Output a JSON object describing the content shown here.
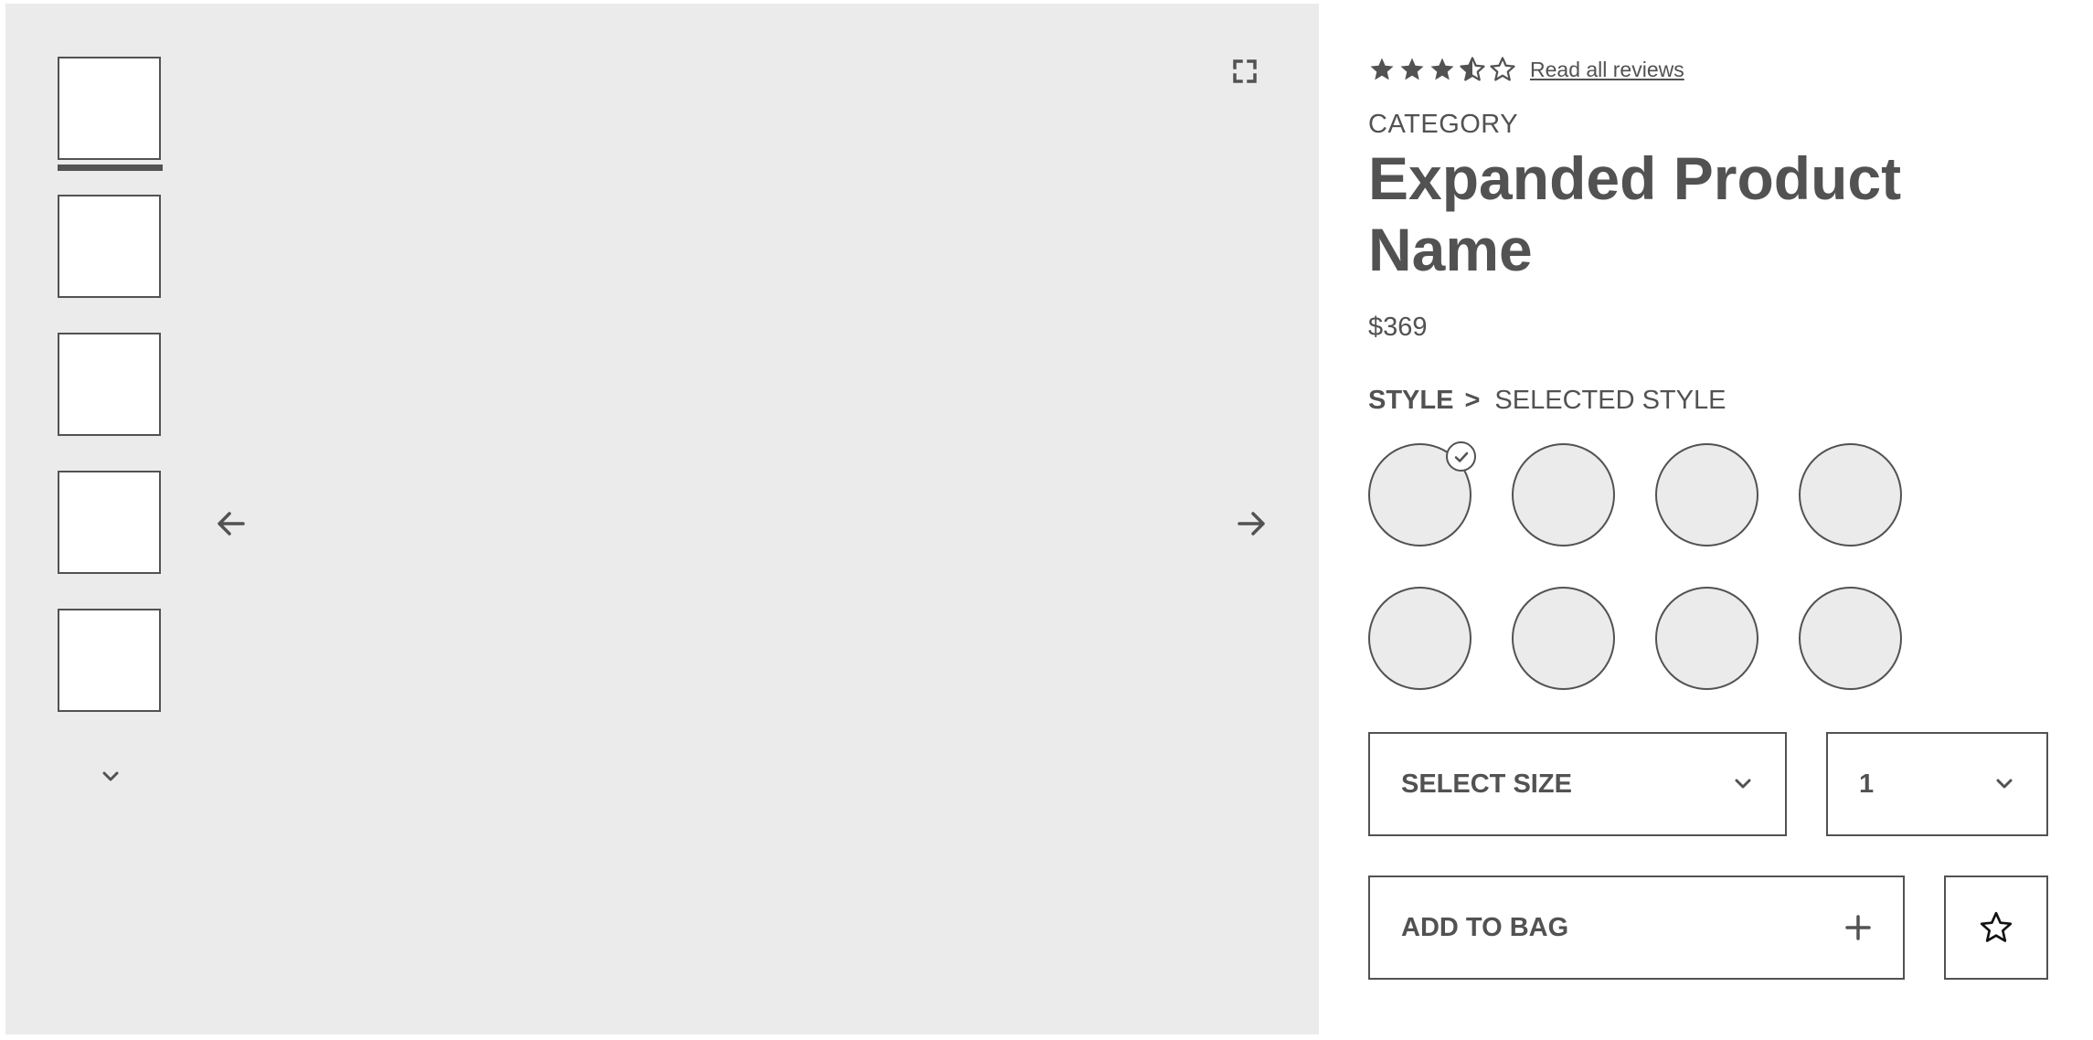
{
  "gallery": {
    "thumbnail_count": 5,
    "selected_thumbnail": 1,
    "icons": {
      "expand": "expand-icon",
      "prev": "arrow-left-icon",
      "next": "arrow-right-icon",
      "scroll_down": "chevron-down-icon"
    }
  },
  "product": {
    "rating": 3.5,
    "rating_max": 5,
    "reviews_link": "Read all reviews",
    "category": "CATEGORY",
    "name": "Expanded Product Name",
    "price": "$369"
  },
  "style": {
    "label": "STYLE",
    "separator": ">",
    "selected": "SELECTED STYLE",
    "swatch_count": 8,
    "selected_swatch": 1
  },
  "size_select": {
    "value": "SELECT SIZE"
  },
  "quantity_select": {
    "value": "1"
  },
  "add_to_bag": {
    "label": "ADD TO BAG",
    "icon": "plus-icon"
  },
  "favorite": {
    "icon": "star-outline-icon"
  },
  "colors": {
    "primary": "#525252",
    "gallery_bg": "#ebebeb",
    "surface": "#ffffff"
  }
}
